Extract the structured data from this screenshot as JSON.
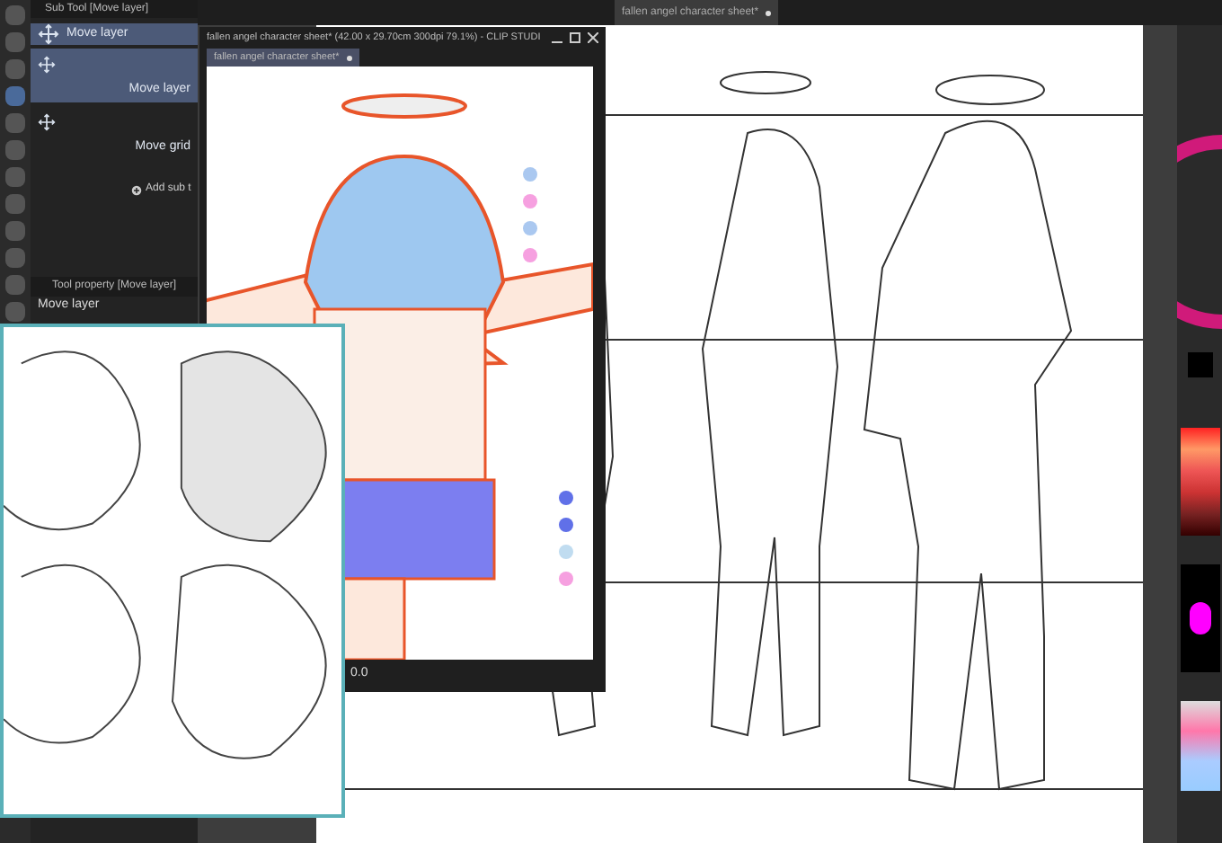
{
  "canvas_tab": {
    "label": "fallen angel character sheet*"
  },
  "sub_tool": {
    "title": "Sub Tool [Move layer]",
    "items": [
      {
        "label": "Move layer",
        "kind": "compact",
        "selected": true
      },
      {
        "label": "Move layer",
        "kind": "large",
        "selected": true
      },
      {
        "label": "Move grid",
        "kind": "large",
        "selected": false
      }
    ],
    "add_button": "Add sub t"
  },
  "tool_property": {
    "title": "Tool property [Move layer]",
    "value": "Move layer"
  },
  "float_window": {
    "title": "fallen angel character sheet* (42.00 x 29.70cm 300dpi 79.1%) - CLIP STUDI",
    "tab": "fallen angel character sheet*",
    "zoom": "0.0"
  }
}
